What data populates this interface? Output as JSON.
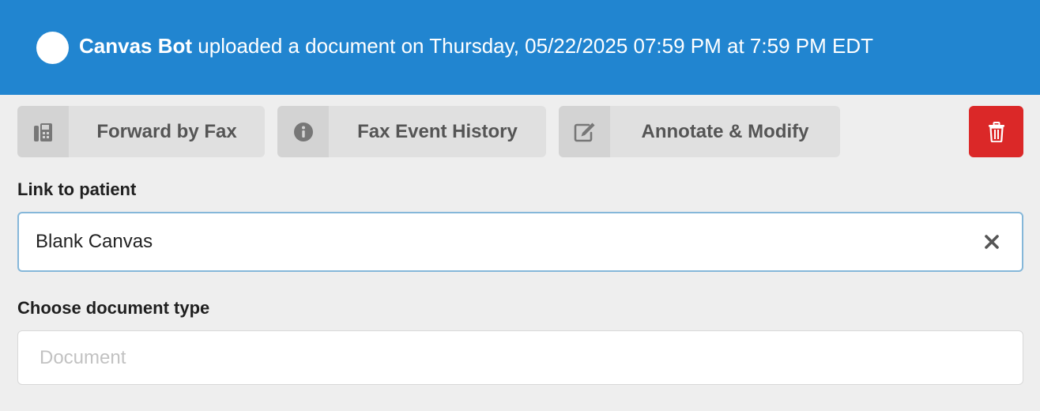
{
  "colors": {
    "accent": "#2185d0",
    "danger": "#db2828",
    "background": "#eeeeee"
  },
  "banner": {
    "actor": "Canvas Bot",
    "message": "uploaded a document on Thursday, 05/22/2025 07:59 PM at 7:59 PM EDT",
    "avatar_icon": "user-avatar-circle"
  },
  "toolbar": {
    "forward_fax": {
      "label": "Forward by Fax",
      "icon": "fax-icon"
    },
    "fax_history": {
      "label": "Fax Event History",
      "icon": "info-icon"
    },
    "annotate": {
      "label": "Annotate & Modify",
      "icon": "edit-icon"
    },
    "delete": {
      "icon": "trash-icon"
    }
  },
  "link_patient": {
    "label": "Link to patient",
    "value": "Blank Canvas",
    "clear_icon": "close-icon"
  },
  "document_type": {
    "label": "Choose document type",
    "placeholder": "Document",
    "value": ""
  }
}
